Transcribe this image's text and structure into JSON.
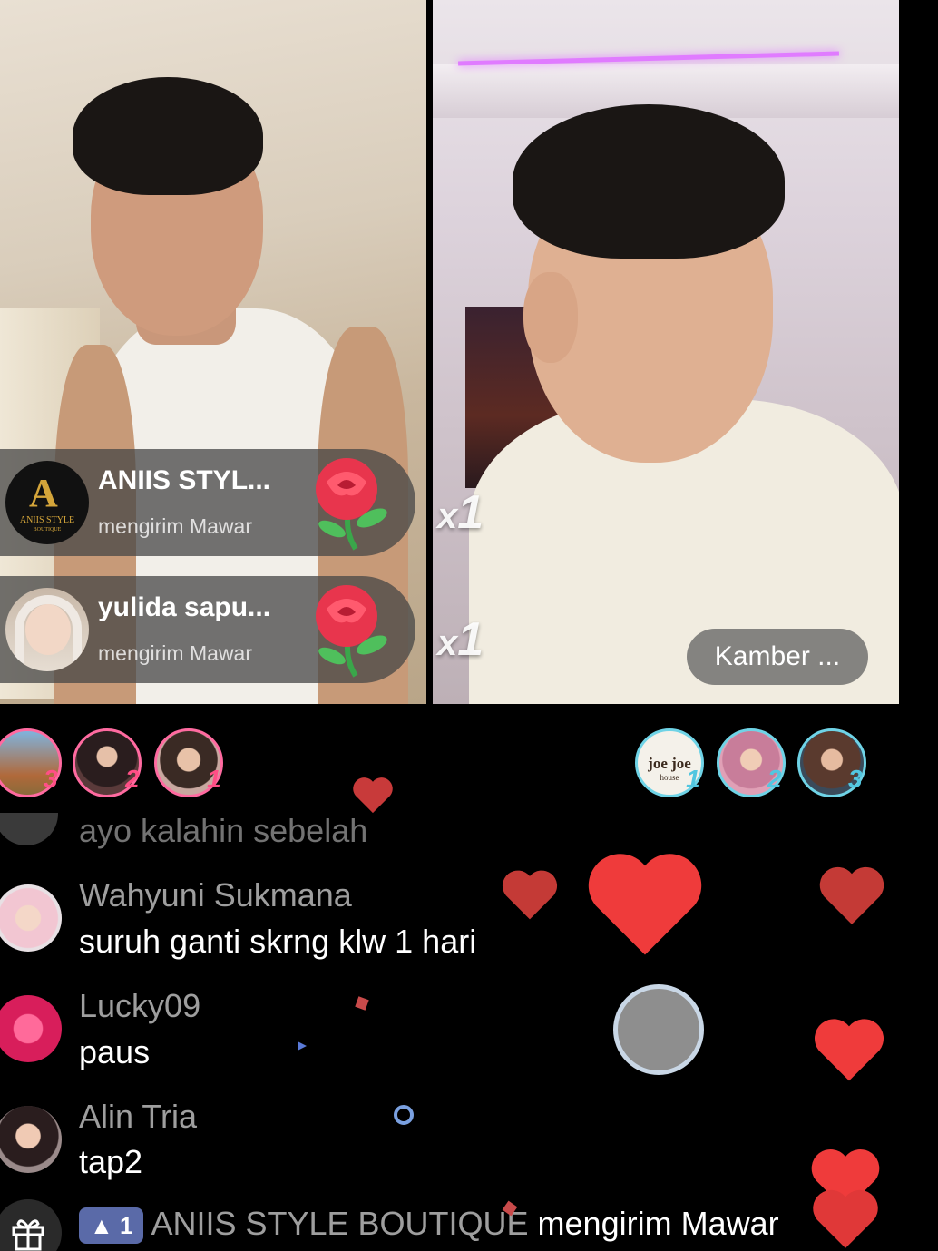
{
  "left_stream": {
    "gift_notifications": [
      {
        "user": "ANIIS STYL...",
        "action": "mengirim Mawar",
        "avatar_text": "ANIIS STYLE",
        "avatar_subtext": "BOUTIQUE",
        "gift": "rose"
      },
      {
        "user": "yulida sapu...",
        "action": "mengirim Mawar",
        "gift": "rose"
      }
    ]
  },
  "right_stream": {
    "combos": [
      {
        "label": "x",
        "count": "1"
      },
      {
        "label": "x",
        "count": "1"
      }
    ],
    "host_name": "Kamber ..."
  },
  "rankings": {
    "left": [
      {
        "rank": "3"
      },
      {
        "rank": "2"
      },
      {
        "rank": "1"
      }
    ],
    "right": [
      {
        "rank": "1",
        "avatar_text": "joe joe",
        "avatar_subtext": "house"
      },
      {
        "rank": "2"
      },
      {
        "rank": "3"
      }
    ]
  },
  "chat": {
    "faded_message": "ayo kalahin sebelah",
    "messages": [
      {
        "user": "Wahyuni Sukmana",
        "text": "suruh ganti skrng klw 1 hari"
      },
      {
        "user": "Lucky09",
        "text": "paus"
      },
      {
        "user": "Alin Tria",
        "text": "tap2"
      }
    ],
    "gift_event": {
      "level": "1",
      "sender": "ANIIS STYLE BOUTIQUE",
      "action": "mengirim Mawar"
    }
  },
  "colors": {
    "heart": "#ef3b3b",
    "rank_pink": "#ff4f86",
    "rank_cyan": "#52c6e0",
    "level_badge": "#5a6aa8"
  }
}
